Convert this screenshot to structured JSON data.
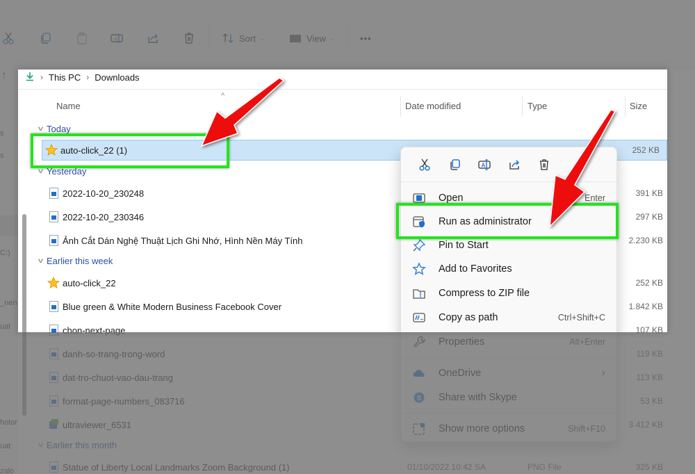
{
  "toolbar": {
    "sort_label": "Sort",
    "view_label": "View",
    "more_label": "•••",
    "icons": [
      "cut-icon",
      "copy-icon",
      "paste-icon",
      "rename-icon",
      "share-icon",
      "delete-icon"
    ]
  },
  "nav_pane": {
    "labels": [
      "s",
      "s",
      "C:)",
      "_nen",
      "uat",
      "hotor",
      "uat",
      "zalo"
    ]
  },
  "breadcrumb": {
    "root_icon": "download-icon",
    "items": [
      "This PC",
      "Downloads"
    ]
  },
  "columns": {
    "name": "Name",
    "date_modified": "Date modified",
    "type": "Type",
    "size": "Size"
  },
  "groups": [
    {
      "label": "Today",
      "files": [
        {
          "name": "auto-click_22 (1)",
          "icon": "star-app-icon",
          "size": "252 KB",
          "selected": true
        }
      ]
    },
    {
      "label": "Yesterday",
      "files": [
        {
          "name": "2022-10-20_230248",
          "icon": "image-file-icon",
          "size": "391 KB"
        },
        {
          "name": "2022-10-20_230346",
          "icon": "image-file-icon",
          "size": "297 KB"
        },
        {
          "name": "Ảnh Cắt Dán Nghệ Thuật Lịch Ghi Nhớ, Hình Nền Máy Tính",
          "icon": "image-file-icon",
          "size": "2.230 KB"
        }
      ]
    },
    {
      "label": "Earlier this week",
      "files": [
        {
          "name": "auto-click_22",
          "icon": "star-app-icon",
          "size": "252 KB"
        },
        {
          "name": "Blue green & White Modern Business Facebook Cover",
          "icon": "image-file-icon",
          "size": "1.842 KB"
        },
        {
          "name": "chon-next-page",
          "icon": "image-file-icon",
          "size": "107 KB"
        },
        {
          "name": "danh-so-trang-trong-word",
          "icon": "image-file-icon",
          "size": "119 KB"
        },
        {
          "name": "dat-tro-chuot-vao-dau-trang",
          "icon": "image-file-icon",
          "size": "113 KB"
        },
        {
          "name": "format-page-numbers_083716",
          "icon": "image-file-icon",
          "size": "53 KB"
        },
        {
          "name": "ultraviewer_6531",
          "icon": "installer-icon",
          "size": "3.412 KB"
        }
      ]
    },
    {
      "label": "Earlier this month",
      "files": [
        {
          "name": "Statue of Liberty Local Landmarks Zoom Background (1)",
          "icon": "image-file-icon",
          "date": "01/10/2022 10:42 SA",
          "type": "PNG File",
          "size": "325 KB"
        }
      ]
    }
  ],
  "context_menu": {
    "quick_actions": [
      "Cut",
      "Copy",
      "Rename",
      "Share",
      "Delete"
    ],
    "items": [
      {
        "label": "Open",
        "icon": "open-icon",
        "shortcut": "Enter"
      },
      {
        "label": "Run as administrator",
        "icon": "shield-window-icon",
        "shortcut": "",
        "highlighted": true
      },
      {
        "label": "Pin to Start",
        "icon": "pin-icon",
        "shortcut": ""
      },
      {
        "label": "Add to Favorites",
        "icon": "star-outline-icon",
        "shortcut": ""
      },
      {
        "label": "Compress to ZIP file",
        "icon": "zip-folder-icon",
        "shortcut": ""
      },
      {
        "label": "Copy as path",
        "icon": "copy-path-icon",
        "shortcut": "Ctrl+Shift+C"
      },
      {
        "label": "Properties",
        "icon": "wrench-icon",
        "shortcut": "Alt+Enter"
      },
      {
        "label": "OneDrive",
        "icon": "onedrive-icon",
        "shortcut": "›"
      },
      {
        "label": "Share with Skype",
        "icon": "skype-icon",
        "shortcut": ""
      },
      {
        "label": "Show more options",
        "icon": "more-options-icon",
        "shortcut": "Shift+F10"
      }
    ]
  },
  "colors": {
    "accent": "#2b7cd3",
    "highlight_box": "#22e61a",
    "annotation_arrow": "#ee1111",
    "selection": "#cce4f7",
    "group_label": "#2b4ea4"
  }
}
